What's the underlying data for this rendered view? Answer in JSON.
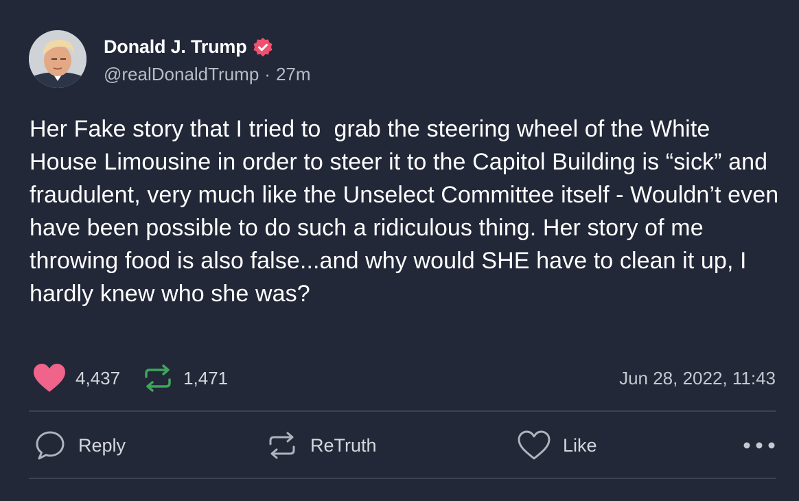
{
  "author": {
    "display_name": "Donald J. Trump",
    "handle": "@realDonaldTrump",
    "separator": "·",
    "relative_time": "27m",
    "verified": true,
    "verified_color": "#f0506e"
  },
  "post": {
    "text": "Her Fake story that I tried to  grab the steering wheel of the White House Limousine in order to steer it to the Capitol Building is “sick” and fraudulent, very much like the Unselect Committee itself - Wouldn’t even have been possible to do such a ridiculous thing. Her story of me throwing food is also false...and why would SHE have to clean it up, I hardly knew who she was?"
  },
  "stats": {
    "likes": "4,437",
    "retruths": "1,471",
    "timestamp": "Jun 28, 2022, 11:43",
    "like_color": "#f0638a",
    "retruth_color": "#3fa55a"
  },
  "actions": {
    "reply_label": "Reply",
    "retruth_label": "ReTruth",
    "like_label": "Like",
    "more_icon": "more-dots-icon"
  },
  "theme": {
    "background": "#222838",
    "divider": "#3b4252",
    "muted_text": "#b8bcc6"
  }
}
